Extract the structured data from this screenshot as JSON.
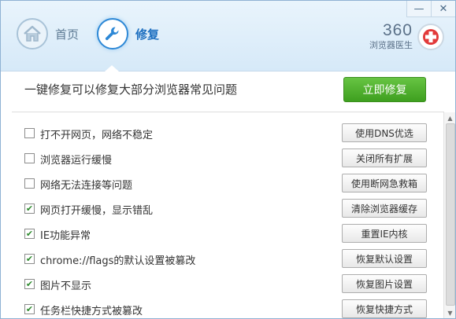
{
  "window": {
    "minimize_icon": "minimize-icon",
    "close_icon": "close-icon",
    "minimize_glyph": "—",
    "close_glyph": "✕"
  },
  "tabs": [
    {
      "label": "首页",
      "icon": "home-icon"
    },
    {
      "label": "修复",
      "icon": "wrench-icon",
      "active": true
    }
  ],
  "brand": {
    "number": "360",
    "subtitle": "浏览器医生",
    "logo_icon": "medical-cross-icon"
  },
  "headline": "一键修复可以修复大部分浏览器常见问题",
  "repair_button": "立即修复",
  "items": [
    {
      "label": "打不开网页，网络不稳定",
      "checked": false,
      "action": "使用DNS优选"
    },
    {
      "label": "浏览器运行缓慢",
      "checked": false,
      "action": "关闭所有扩展"
    },
    {
      "label": "网络无法连接等问题",
      "checked": false,
      "action": "使用断网急救箱"
    },
    {
      "label": "网页打开缓慢，显示错乱",
      "checked": true,
      "action": "清除浏览器缓存"
    },
    {
      "label": "IE功能异常",
      "checked": true,
      "action": "重置IE内核"
    },
    {
      "label": "chrome://flags的默认设置被篡改",
      "checked": true,
      "action": "恢复默认设置"
    },
    {
      "label": "图片不显示",
      "checked": true,
      "action": "恢复图片设置"
    },
    {
      "label": "任务栏快捷方式被篡改",
      "checked": true,
      "action": "恢复快捷方式"
    }
  ],
  "colors": {
    "accent": "#2d88d6",
    "repair_button": "#4cb02c",
    "titlebar": "#dcedf9"
  }
}
